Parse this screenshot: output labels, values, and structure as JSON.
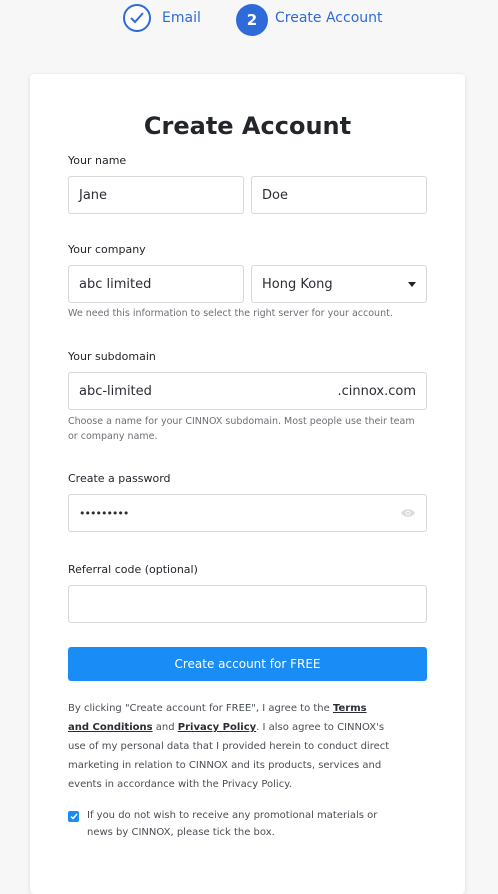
{
  "steps": {
    "step1_label": "Email",
    "step2_number": "2",
    "step2_label": "Create Account"
  },
  "form": {
    "title": "Create Account",
    "name_label": "Your name",
    "first_name": "Jane",
    "last_name": "Doe",
    "company_label": "Your company",
    "company_value": "abc limited",
    "country_value": "Hong Kong",
    "company_hint": "We need this information to select the right server for your account.",
    "subdomain_label": "Your subdomain",
    "subdomain_value": "abc-limited",
    "subdomain_suffix": ".cinnox.com",
    "subdomain_hint": "Choose a name for your CINNOX subdomain. Most people use their team or company name.",
    "password_label": "Create a password",
    "password_value": "•••••••••",
    "referral_label": "Referral code (optional)",
    "referral_value": "",
    "submit_label": "Create account for FREE",
    "terms_prefix": "By clicking \"Create account for FREE\", I agree to the ",
    "terms_link": "Terms and Conditions",
    "terms_and": " and ",
    "privacy_link": "Privacy Policy",
    "terms_suffix": ". I also agree to CINNOX's use of my personal data that I provided herein to conduct direct marketing in relation to CINNOX and its products, services and events in accordance with the Privacy Policy.",
    "optout_text": "If you do not wish to receive any promotional materials or news by CINNOX, please tick the box.",
    "optout_checked": true
  },
  "colors": {
    "accent": "#2e6bd8",
    "button": "#1a8cf5"
  }
}
